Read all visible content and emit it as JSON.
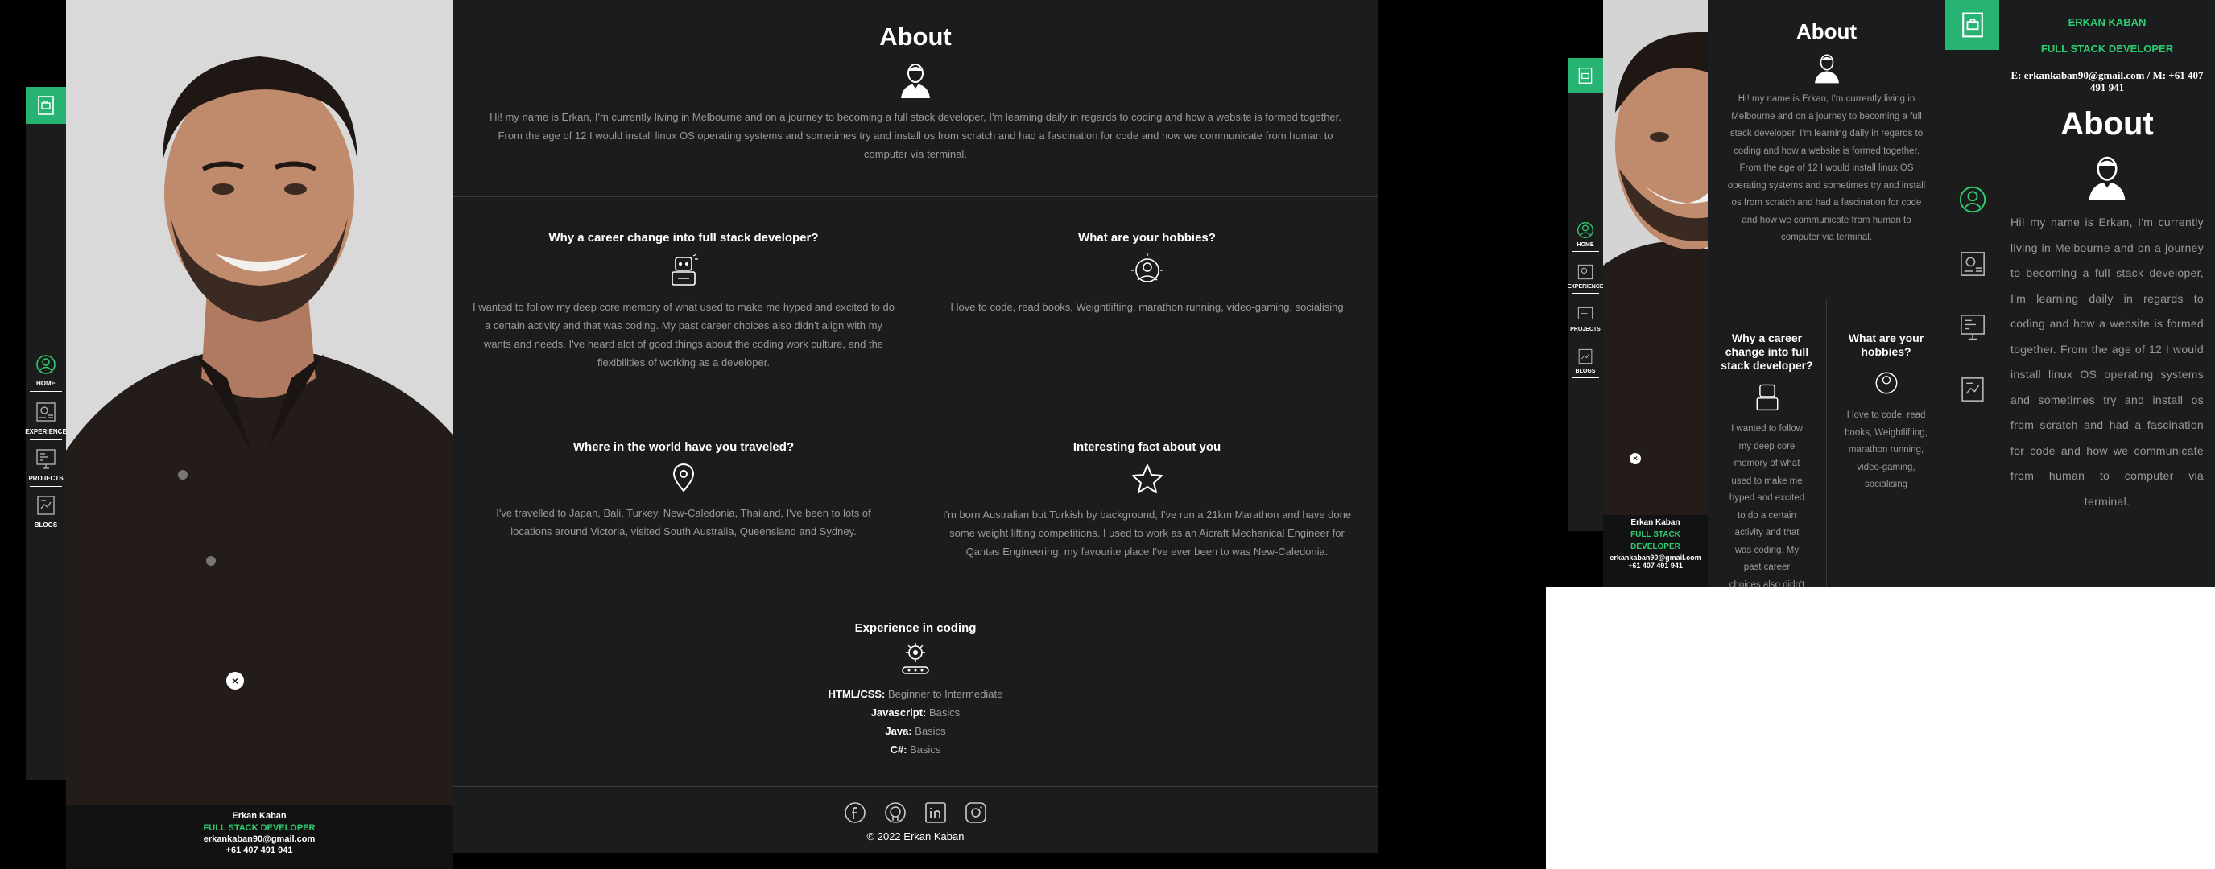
{
  "nav": {
    "items": [
      {
        "label": "HOME",
        "icon": "user-circle-icon"
      },
      {
        "label": "EXPERIENCE",
        "icon": "gear-resume-icon"
      },
      {
        "label": "PROJECTS",
        "icon": "board-icon"
      },
      {
        "label": "BLOGS",
        "icon": "chart-doc-icon"
      }
    ]
  },
  "profile": {
    "name": "Erkan Kaban",
    "title": "FULL STACK DEVELOPER",
    "email": "erkankaban90@gmail.com",
    "phone": "+61 407 491 941",
    "tab_email_line": "erkankaban90@gmail.com",
    "tab_title_short": "FULL STACK",
    "tab_title_rest": "DEVELOPER"
  },
  "about": {
    "heading": "About",
    "intro": "Hi! my name is Erkan, I'm currently living in Melbourne and on a journey to becoming a full stack developer, I'm learning daily in regards to coding and how a website is formed together. From the age of 12 I would install linux OS operating systems and sometimes try and install os from scratch and had a fascination for code and how we communicate from human to computer via terminal."
  },
  "sections": {
    "career": {
      "heading": "Why a career change into full stack developer?",
      "body": "I wanted to follow my deep core memory of what used to make me hyped and excited to do a certain activity and that was coding. My past career choices also didn't align with my wants and needs. I've heard alot of good things about the coding work culture, and the flexibilities of working as a developer."
    },
    "hobbies": {
      "heading": "What are your hobbies?",
      "body": "I love to code, read books, Weightlifting, marathon running, video-gaming, socialising"
    },
    "travel": {
      "heading": "Where in the world have you traveled?",
      "body": "I've travelled to Japan, Bali, Turkey, New-Caledonia, Thailand, I've been to lots of locations around Victoria, visited South Australia, Queensland and Sydney."
    },
    "fact": {
      "heading": "Interesting fact about you",
      "body": "I'm born Australian but Turkish by background, I've run a 21km Marathon and have done some weight lifting competitions. I used to work as an Aicraft Mechanical Engineer for Qantas Engineering, my favourite place I've ever been to was New-Caledonia."
    }
  },
  "experience": {
    "heading": "Experience in coding",
    "skills": [
      {
        "name": "HTML/CSS:",
        "level": "Beginner to Intermediate"
      },
      {
        "name": "Javascript:",
        "level": "Basics"
      },
      {
        "name": "Java:",
        "level": "Basics"
      },
      {
        "name": "C#:",
        "level": "Basics"
      }
    ]
  },
  "footer": {
    "social": [
      "facebook-icon",
      "github-icon",
      "linkedin-icon",
      "instagram-icon"
    ],
    "copyright": "© 2022 Erkan Kaban"
  },
  "tablet": {
    "career_heading": "Why a career change into full stack developer?",
    "hobbies_heading": "What are your hobbies?",
    "career_body_partial": "I wanted to follow my deep core memory of what used to make me hyped and excited to do a certain activity and that was coding. My past career choices also didn't align with my",
    "hobbies_body": "I love to code, read books, Weightlifting, marathon running, video-gaming, socialising"
  },
  "mobile": {
    "name_caps": "ERKAN KABAN",
    "title": "FULL STACK DEVELOPER",
    "contact_line": "E: erkankaban90@gmail.com / M: +61 407 491 941",
    "heading": "About"
  },
  "colors": {
    "accent": "#27b473",
    "background": "#1b1c1e",
    "sidebar": "#1c1c1c"
  }
}
